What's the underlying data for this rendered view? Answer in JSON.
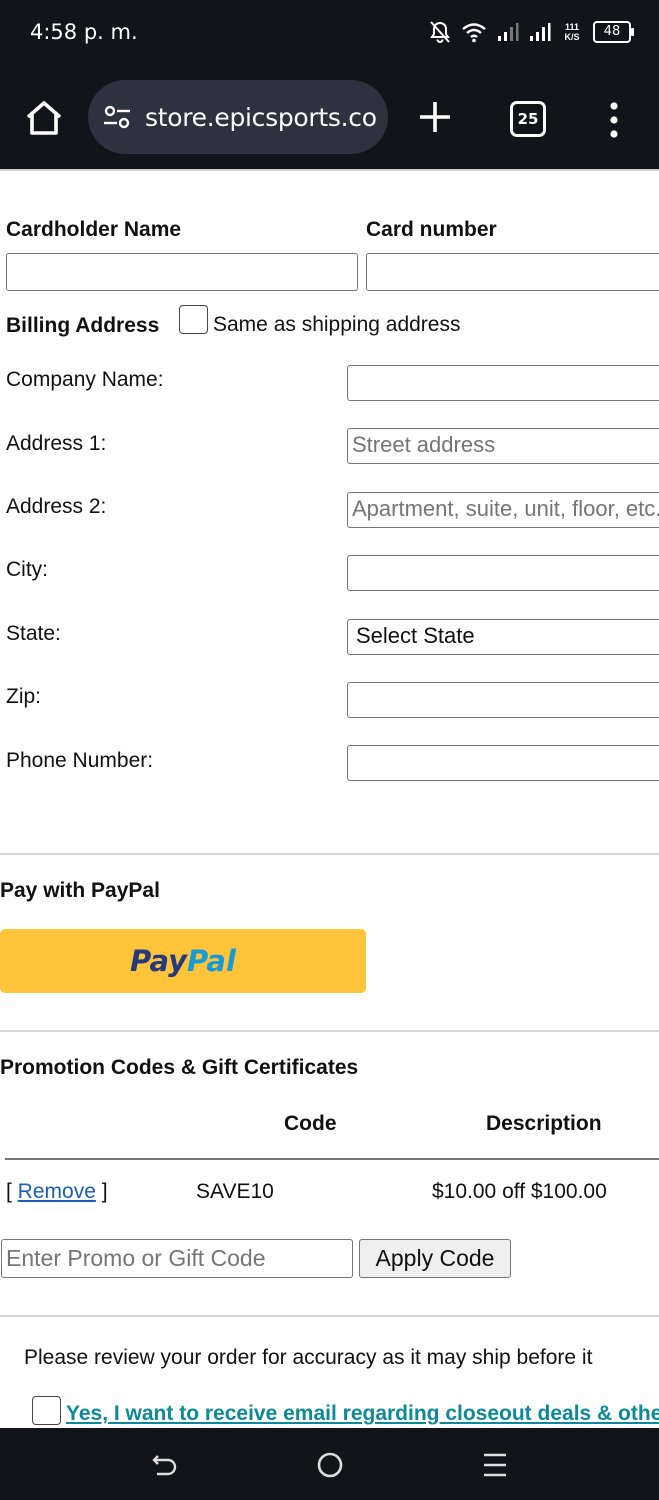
{
  "status_bar": {
    "time": "4:58 p. m.",
    "network_speed": "111 K/S",
    "battery": "48"
  },
  "browser": {
    "url": "store.epicsports.com",
    "tab_count": "25"
  },
  "card": {
    "cardholder_label": "Cardholder Name",
    "card_number_label": "Card number",
    "cardholder_value": "",
    "card_number_value": ""
  },
  "billing": {
    "heading": "Billing Address",
    "same_as_shipping_label": "Same as shipping address",
    "company_label": "Company Name:",
    "address1_label": "Address 1:",
    "address1_placeholder": "Street address",
    "address2_label": "Address 2:",
    "address2_placeholder": "Apartment, suite, unit, floor, etc.",
    "city_label": "City:",
    "state_label": "State:",
    "state_selected": "Select State",
    "zip_label": "Zip:",
    "phone_label": "Phone Number:"
  },
  "paypal": {
    "heading": "Pay with PayPal",
    "logo_part1": "Pay",
    "logo_part2": "Pal"
  },
  "promo": {
    "heading": "Promotion Codes & Gift Certificates",
    "columns": [
      "Code",
      "Description"
    ],
    "rows": [
      {
        "action_open": "[ ",
        "action": "Remove",
        "action_close": " ]",
        "code": "SAVE10",
        "description": "$10.00 off $100.00"
      }
    ],
    "input_placeholder": "Enter Promo or Gift Code",
    "apply_label": "Apply Code"
  },
  "review": {
    "notice": "Please review your order for accuracy as it may ship before it",
    "optin_label": "Yes, I want to receive email regarding closeout deals & other"
  },
  "colors": {
    "paypal_yellow": "#ffc439",
    "paypal_dark": "#253b80",
    "paypal_light": "#179bd7",
    "link_blue": "#1a5fb4",
    "optin_teal": "#0c8a98",
    "system_bar": "#111418"
  }
}
